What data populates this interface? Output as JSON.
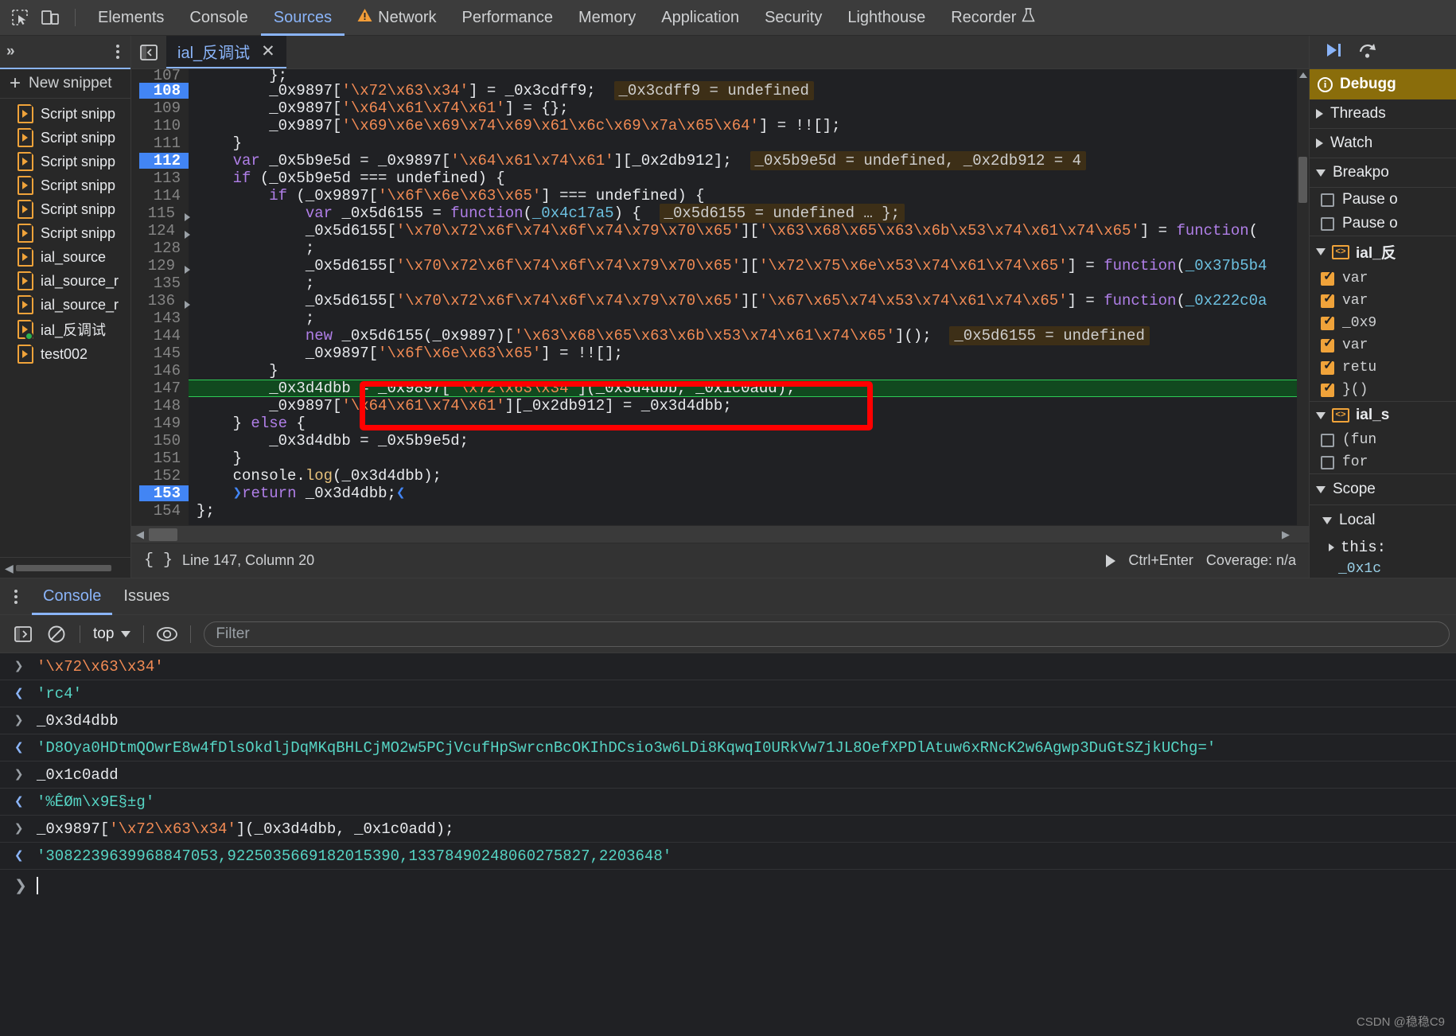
{
  "topbar": {
    "icons": [
      "inspect-element-icon",
      "device-toolbar-icon"
    ],
    "tabs": [
      {
        "label": "Elements",
        "active": false,
        "warn": false
      },
      {
        "label": "Console",
        "active": false,
        "warn": false
      },
      {
        "label": "Sources",
        "active": true,
        "warn": false
      },
      {
        "label": "Network",
        "active": false,
        "warn": true
      },
      {
        "label": "Performance",
        "active": false,
        "warn": false
      },
      {
        "label": "Memory",
        "active": false,
        "warn": false
      },
      {
        "label": "Application",
        "active": false,
        "warn": false
      },
      {
        "label": "Security",
        "active": false,
        "warn": false
      },
      {
        "label": "Lighthouse",
        "active": false,
        "warn": false
      },
      {
        "label": "Recorder",
        "active": false,
        "warn": false,
        "flask": true
      }
    ]
  },
  "navigator": {
    "more_tabs_label": "»",
    "new_snippet_label": "New snippet",
    "items": [
      {
        "label": "Script snipp",
        "active": false
      },
      {
        "label": "Script snipp",
        "active": false
      },
      {
        "label": "Script snipp",
        "active": false
      },
      {
        "label": "Script snipp",
        "active": false
      },
      {
        "label": "Script snipp",
        "active": false
      },
      {
        "label": "Script snipp",
        "active": false
      },
      {
        "label": "ial_source",
        "active": false
      },
      {
        "label": "ial_source_r",
        "active": false
      },
      {
        "label": "ial_source_r",
        "active": false
      },
      {
        "label": "ial_反调试",
        "active": true
      },
      {
        "label": "test002",
        "active": false
      }
    ]
  },
  "editor": {
    "file_tab": "ial_反调试",
    "close_label": "✕",
    "lines": [
      {
        "num": "107",
        "bp": false,
        "fold": false,
        "exec": false,
        "partial": true
      },
      {
        "num": "108",
        "bp": true,
        "fold": false,
        "exec": false
      },
      {
        "num": "109",
        "bp": false,
        "fold": false,
        "exec": false
      },
      {
        "num": "110",
        "bp": false,
        "fold": false,
        "exec": false
      },
      {
        "num": "111",
        "bp": false,
        "fold": false,
        "exec": false
      },
      {
        "num": "112",
        "bp": true,
        "fold": false,
        "exec": false
      },
      {
        "num": "113",
        "bp": false,
        "fold": false,
        "exec": false
      },
      {
        "num": "114",
        "bp": false,
        "fold": false,
        "exec": false
      },
      {
        "num": "115",
        "bp": false,
        "fold": true,
        "exec": false
      },
      {
        "num": "124",
        "bp": false,
        "fold": true,
        "exec": false
      },
      {
        "num": "128",
        "bp": false,
        "fold": false,
        "exec": false
      },
      {
        "num": "129",
        "bp": false,
        "fold": true,
        "exec": false
      },
      {
        "num": "135",
        "bp": false,
        "fold": false,
        "exec": false
      },
      {
        "num": "136",
        "bp": false,
        "fold": true,
        "exec": false
      },
      {
        "num": "143",
        "bp": false,
        "fold": false,
        "exec": false
      },
      {
        "num": "144",
        "bp": false,
        "fold": false,
        "exec": false
      },
      {
        "num": "145",
        "bp": false,
        "fold": false,
        "exec": false
      },
      {
        "num": "146",
        "bp": false,
        "fold": false,
        "exec": false
      },
      {
        "num": "147",
        "bp": false,
        "fold": false,
        "exec": true
      },
      {
        "num": "148",
        "bp": false,
        "fold": false,
        "exec": false
      },
      {
        "num": "149",
        "bp": false,
        "fold": false,
        "exec": false
      },
      {
        "num": "150",
        "bp": false,
        "fold": false,
        "exec": false
      },
      {
        "num": "151",
        "bp": false,
        "fold": false,
        "exec": false
      },
      {
        "num": "152",
        "bp": false,
        "fold": false,
        "exec": false
      },
      {
        "num": "153",
        "bp": true,
        "fold": false,
        "exec": false
      },
      {
        "num": "154",
        "bp": false,
        "fold": false,
        "exec": false
      }
    ],
    "code": [
      "        };",
      "        _0x9897['\\x72\\x63\\x34'] = _0x3cdff9;",
      "        _0x9897['\\x64\\x61\\x74\\x61'] = {};",
      "        _0x9897['\\x69\\x6e\\x69\\x74\\x69\\x61\\x6c\\x69\\x7a\\x65\\x64'] = !![];",
      "    }",
      "    var _0x5b9e5d = _0x9897['\\x64\\x61\\x74\\x61'][_0x2db912];",
      "    if (_0x5b9e5d === undefined) {",
      "        if (_0x9897['\\x6f\\x6e\\x63\\x65'] === undefined) {",
      "            var _0x5d6155 = function(_0x4c17a5) {",
      "            _0x5d6155['\\x70\\x72\\x6f\\x74\\x6f\\x74\\x79\\x70\\x65']['\\x63\\x68\\x65\\x63\\x6b\\x53\\x74\\x61\\x74\\x65'] = function()",
      "            ;",
      "            _0x5d6155['\\x70\\x72\\x6f\\x74\\x6f\\x74\\x79\\x70\\x65']['\\x72\\x75\\x6e\\x53\\x74\\x61\\x74\\x65'] = function(_0x37b5b4",
      "            ;",
      "            _0x5d6155['\\x70\\x72\\x6f\\x74\\x6f\\x74\\x79\\x70\\x65']['\\x67\\x65\\x74\\x53\\x74\\x61\\x74\\x65'] = function(_0x222c0a",
      "            ;",
      "            new _0x5d6155(_0x9897)['\\x63\\x68\\x65\\x63\\x6b\\x53\\x74\\x61\\x74\\x65']();",
      "            _0x9897['\\x6f\\x6e\\x63\\x65'] = !![];",
      "        }",
      "        _0x3d4dbb = _0x9897['\\x72\\x63\\x34'](_0x3d4dbb, _0x1c0add);",
      "        _0x9897['\\x64\\x61\\x74\\x61'][_0x2db912] = _0x3d4dbb;",
      "    } else {",
      "        _0x3d4dbb = _0x5b9e5d;",
      "    }",
      "    console.log(_0x3d4dbb);",
      "    return _0x3d4dbb;",
      "};"
    ],
    "inline_hints": [
      {
        "line_index": 1,
        "text": "_0x3cdff9 = undefined"
      },
      {
        "line_index": 5,
        "text": "_0x5b9e5d = undefined, _0x2db912 = 4"
      },
      {
        "line_index": 8,
        "text": "_0x5d6155 = undefined … };"
      },
      {
        "line_index": 15,
        "text": "_0x5d6155 = undefined"
      }
    ],
    "status": {
      "position": "Line 147, Column 20",
      "run_shortcut": "Ctrl+Enter",
      "coverage": "Coverage: n/a"
    }
  },
  "debugger": {
    "banner": "Debugg",
    "sections": [
      {
        "label": "Threads",
        "expanded": false
      },
      {
        "label": "Watch",
        "expanded": false
      },
      {
        "label": "Breakpo",
        "expanded": true
      }
    ],
    "pause_options": [
      {
        "label": "Pause o",
        "checked": false
      },
      {
        "label": "Pause o",
        "checked": false
      }
    ],
    "breakpoint_groups": [
      {
        "file": "ial_反",
        "items": [
          {
            "label": "var",
            "checked": true
          },
          {
            "label": "var",
            "checked": true
          },
          {
            "label": "_0x9",
            "checked": true
          },
          {
            "label": "var",
            "checked": true
          },
          {
            "label": "retu",
            "checked": true
          },
          {
            "label": "}()",
            "checked": true
          }
        ]
      },
      {
        "file": "ial_s",
        "items": [
          {
            "label": "(fun",
            "checked": false
          },
          {
            "label": "for",
            "checked": false
          }
        ]
      }
    ],
    "scope_label": "Scope",
    "local_label": "Local",
    "this_label": "this:",
    "local_var": "_0x1c"
  },
  "drawer": {
    "tabs": [
      {
        "label": "Console",
        "active": true
      },
      {
        "label": "Issues",
        "active": false
      }
    ],
    "toolbar": {
      "sidebar_icon": "console-sidebar-icon",
      "clear_icon": "clear-console-icon",
      "context_label": "top",
      "eye_icon": "live-expression-icon",
      "filter_placeholder": "Filter"
    },
    "logs": [
      {
        "dir": "in",
        "text": "'\\x72\\x63\\x34'",
        "style": "str"
      },
      {
        "dir": "out",
        "text": "'rc4'",
        "style": "res"
      },
      {
        "dir": "in",
        "text": "_0x3d4dbb",
        "style": "plain"
      },
      {
        "dir": "out",
        "text": "'D8Oya0HDtmQOwrE8w4fDlsOkdljDqMKqBHLCjMO2w5PCjVcufHpSwrcnBcOKIhDCsio3w6LDi8KqwqI0URkVw71JL8OefXPDlAtuw6xRNcK2w6Agwp3DuGtSZjkUChg='",
        "style": "res"
      },
      {
        "dir": "in",
        "text": "_0x1c0add",
        "style": "plain"
      },
      {
        "dir": "out",
        "text": "'%ÊØm\\x9E§±g'",
        "style": "res"
      },
      {
        "dir": "in",
        "text": "_0x9897['\\x72\\x63\\x34'](_0x3d4dbb, _0x1c0add);",
        "style": "mixed"
      },
      {
        "dir": "out",
        "text": "'308223963996884705 3,9225035669182015390,13378490248060275827,2203648'",
        "style": "res"
      }
    ],
    "final_log_text": "'3082239639968847053,9225035669182015390,13378490248060275827,2203648'"
  },
  "watermark": "CSDN @稳稳C9",
  "colors": {
    "accent": "#8ab4f8",
    "breakpoint": "#4285f4",
    "exec_line": "#11491f",
    "exec_border": "#2ecc55",
    "snippet_icon": "#f0a33a",
    "string": "#f28b54",
    "keyword": "#b07fe8",
    "result": "#56d4c4",
    "banner": "#8a6d0b",
    "annotation_box": "#ff0000"
  }
}
